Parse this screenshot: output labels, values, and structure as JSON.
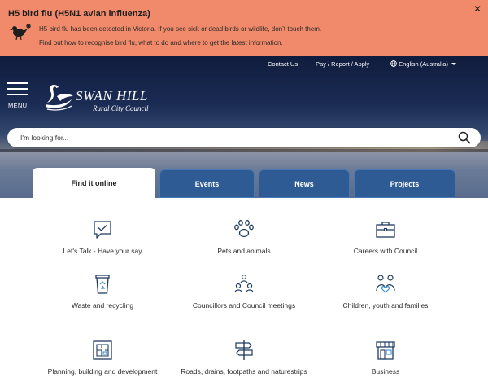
{
  "alert": {
    "title": "H5 bird flu (H5N1 avian influenza)",
    "message": "H5 bird flu has been detected in Victoria. If you see sick or dead birds or wildlife, don’t touch them.",
    "link": "Find out how to recognise bird flu, what to do and where to get the latest information.",
    "close": "✕",
    "icon": "bird-icon",
    "background": "#f08a6b"
  },
  "utility": {
    "contact": "Contact Us",
    "pay": "Pay / Report / Apply",
    "language": "English (Australia)"
  },
  "header": {
    "menu_label": "MENU",
    "logo_title": "SWAN HILL",
    "logo_subtitle": "Rural City Council"
  },
  "search": {
    "placeholder": "I'm looking for..."
  },
  "tabs": [
    {
      "label": "Find it online",
      "active": true
    },
    {
      "label": "Events",
      "active": false
    },
    {
      "label": "News",
      "active": false
    },
    {
      "label": "Projects",
      "active": false
    }
  ],
  "services": [
    {
      "label": "Let's Talk - Have your say",
      "icon": "chat-check-icon"
    },
    {
      "label": "Pets and animals",
      "icon": "paw-icon"
    },
    {
      "label": "Careers with Council",
      "icon": "briefcase-icon"
    },
    {
      "label": "Waste and recycling",
      "icon": "recycle-bin-icon"
    },
    {
      "label": "Councillors and Council meetings",
      "icon": "people-group-icon"
    },
    {
      "label": "Children, youth and families",
      "icon": "family-icon"
    },
    {
      "label": "Planning, building and development",
      "icon": "blueprint-icon"
    },
    {
      "label": "Roads, drains, footpaths and naturestrips",
      "icon": "signpost-icon"
    },
    {
      "label": "Business",
      "icon": "shopfront-icon"
    }
  ],
  "colors": {
    "tab_blue": "#2f5b95",
    "hero_sky": "#1b2c55"
  }
}
